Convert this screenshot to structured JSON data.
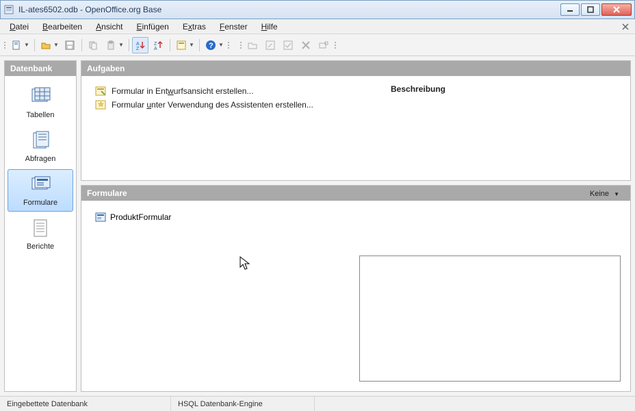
{
  "window": {
    "title": "IL-ates6502.odb - OpenOffice.org Base"
  },
  "menu": {
    "file": "Datei",
    "edit": "Bearbeiten",
    "view": "Ansicht",
    "insert": "Einfügen",
    "extras": "Extras",
    "window": "Fenster",
    "help": "Hilfe"
  },
  "sidebar": {
    "header": "Datenbank",
    "items": [
      {
        "label": "Tabellen"
      },
      {
        "label": "Abfragen"
      },
      {
        "label": "Formulare"
      },
      {
        "label": "Berichte"
      }
    ]
  },
  "tasks": {
    "header": "Aufgaben",
    "items": [
      {
        "label_pre": "Formular in Ent",
        "label_u": "w",
        "label_post": "urfsansicht erstellen..."
      },
      {
        "label_pre": "Formular ",
        "label_u": "u",
        "label_post": "nter Verwendung des Assistenten erstellen..."
      }
    ],
    "description_label": "Beschreibung"
  },
  "forms": {
    "header": "Formulare",
    "items": [
      {
        "label": "ProduktFormular"
      }
    ],
    "view_mode_label": "Keine"
  },
  "status": {
    "left": "Eingebettete Datenbank",
    "engine": "HSQL Datenbank-Engine"
  }
}
